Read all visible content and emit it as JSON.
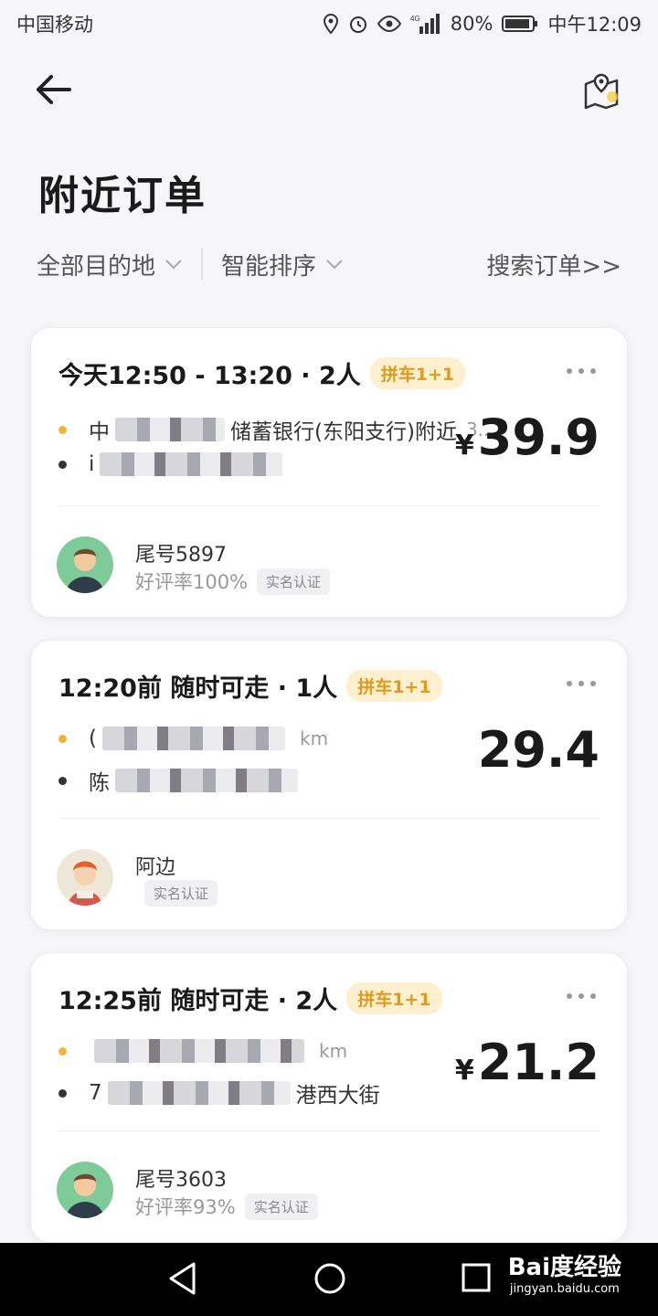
{
  "status": {
    "carrier": "中国移动",
    "battery": "80%",
    "time": "中午12:09"
  },
  "header": {
    "title": "附近订单"
  },
  "filters": {
    "destination": "全部目的地",
    "sort": "智能排序",
    "search": "搜索订单>>"
  },
  "orders": [
    {
      "time": "今天12:50 - 13:20 · 2人",
      "tag": "拼车1+1",
      "start_visible": "中",
      "start_suffix": "储蓄银行(东阳支行)附近",
      "start_distance": "3...",
      "end_visible": "i",
      "currency": "¥",
      "price": "39.9",
      "user_name": "尾号5897",
      "rating": "好评率100%",
      "verified": "实名认证"
    },
    {
      "time": "12:20前 随时可走 · 1人",
      "tag": "拼车1+1",
      "start_visible": "(",
      "start_suffix": "",
      "start_distance": "km",
      "end_visible": "陈",
      "currency": "",
      "price": "29.4",
      "user_name": "阿边",
      "rating": "",
      "verified": "实名认证"
    },
    {
      "time": "12:25前 随时可走 · 2人",
      "tag": "拼车1+1",
      "start_visible": "",
      "start_suffix": "",
      "start_distance": "km",
      "end_visible": "7",
      "end_suffix": "港西大街",
      "currency": "¥",
      "price": "21.2",
      "user_name": "尾号3603",
      "rating": "好评率93%",
      "verified": "实名认证"
    }
  ],
  "watermark": {
    "main": "Bai度经验",
    "sub": "jingyan.baidu.com"
  },
  "icons": {
    "back": "arrow-left-icon",
    "map": "map-pin-icon",
    "more": "more-dots-icon",
    "chevron": "chevron-down-icon"
  },
  "colors": {
    "accent": "#f2b33a",
    "tag_bg": "#fdf0cf",
    "tag_text": "#e09a1d"
  }
}
